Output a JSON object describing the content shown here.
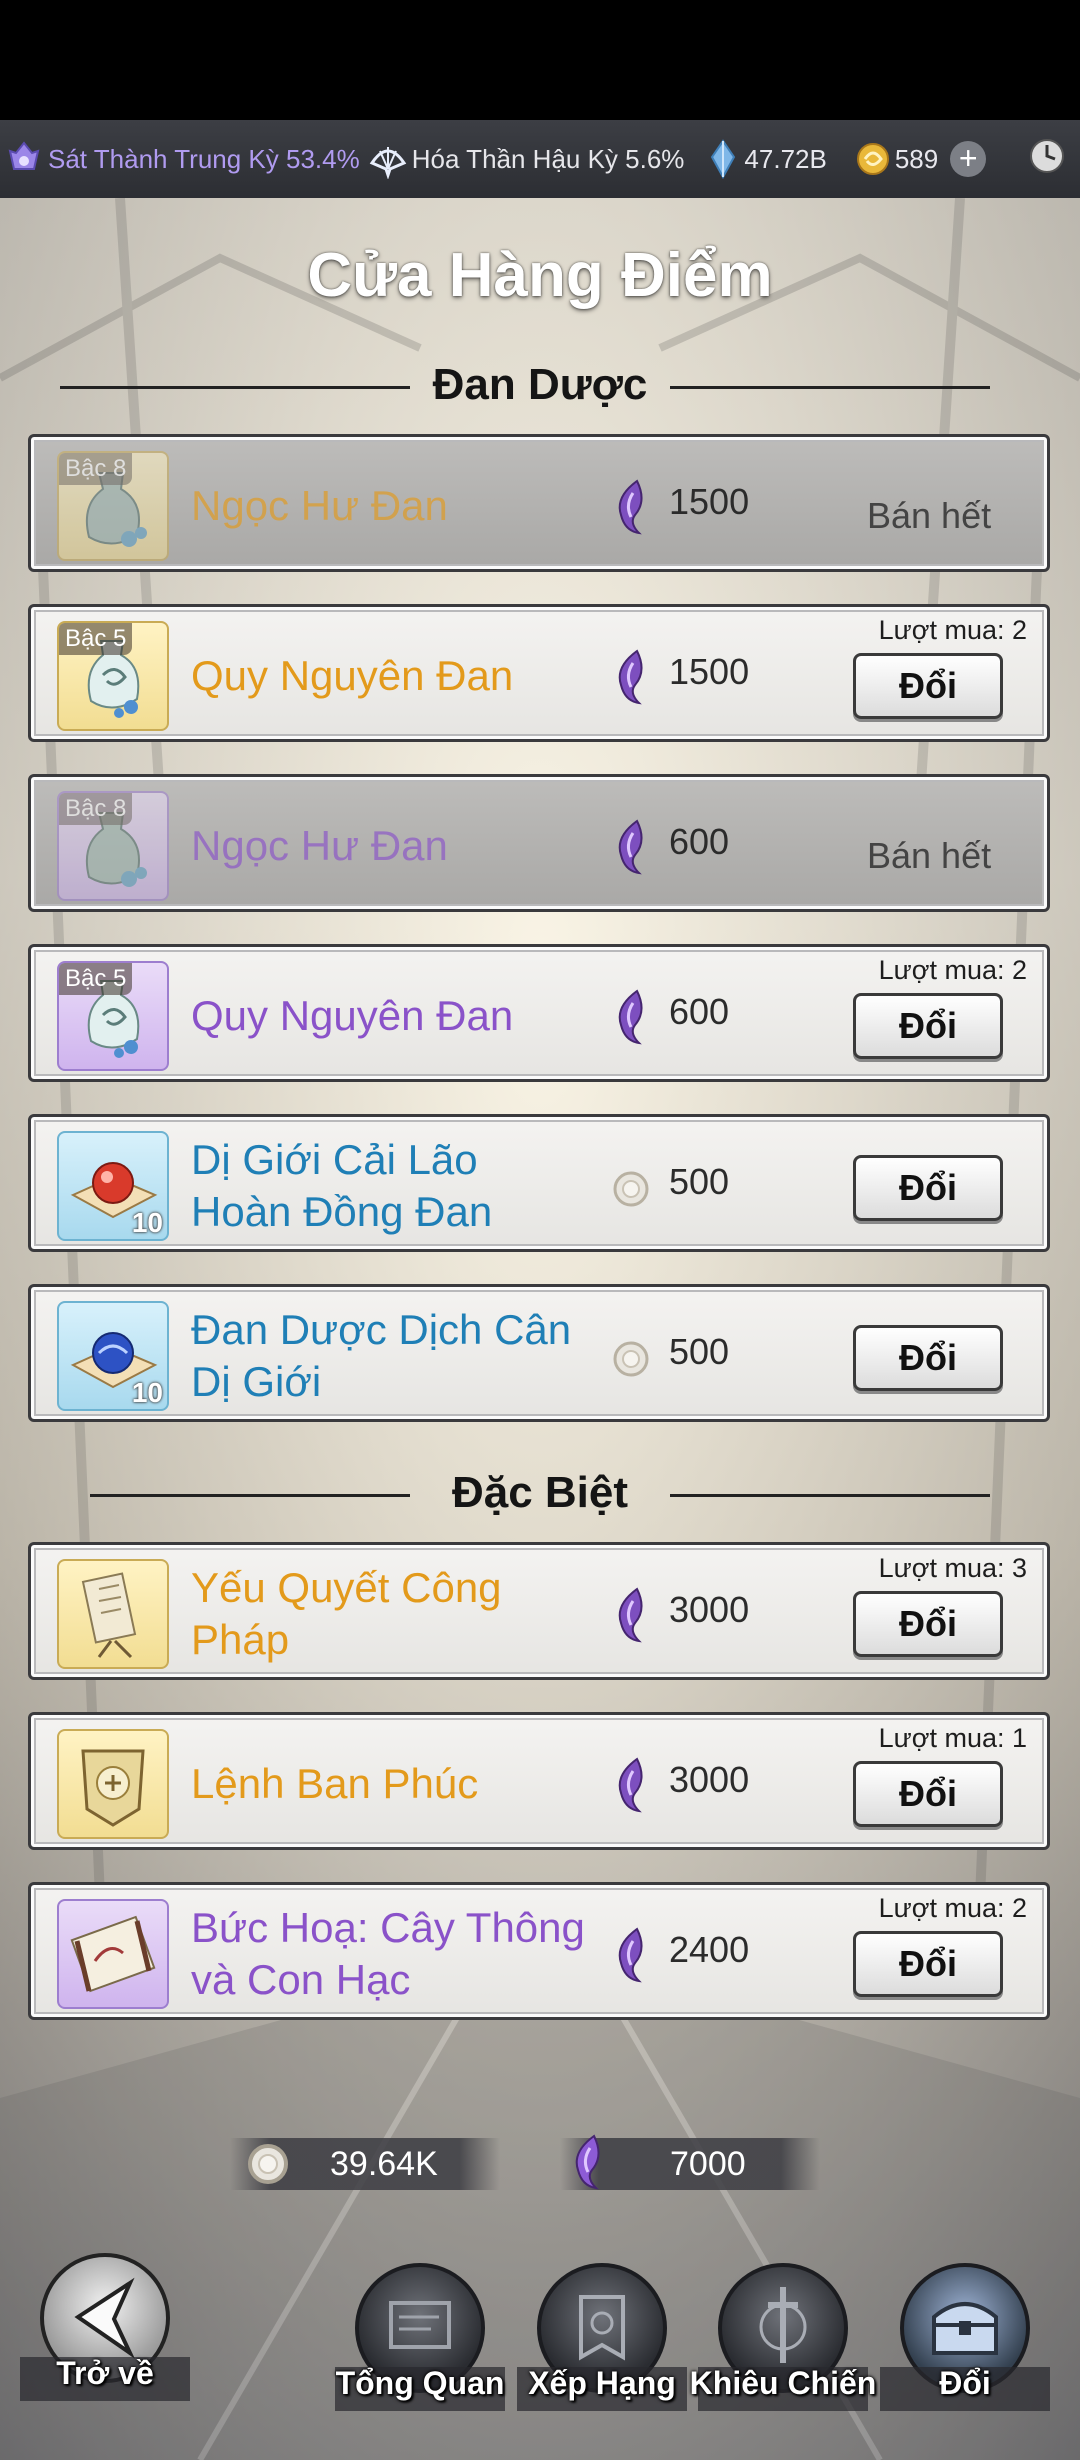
{
  "status_bar": {
    "cultivation": "Sát Thành Trung Kỳ 53.4%",
    "soul": "Hóa Thần Hậu Kỳ 5.6%",
    "gems": "47.72B",
    "coins": "589",
    "plus_icon": "plus-icon",
    "clock_icon": "clock-icon"
  },
  "title": "Cửa Hàng Điểm",
  "sections": {
    "pills": "Đan Dược",
    "special": "Đặc Biệt"
  },
  "items": [
    {
      "tier": "Bậc 8",
      "name": "Ngọc Hư Đan",
      "currency": "purple-flame",
      "price": "1500",
      "limit": "",
      "status": "Bán hết",
      "button": "",
      "color": "gold"
    },
    {
      "tier": "Bậc 5",
      "name": "Quy Nguyên Đan",
      "currency": "purple-flame",
      "price": "1500",
      "limit": "Lượt mua: 2",
      "status": "",
      "button": "Đổi",
      "color": "gold"
    },
    {
      "tier": "Bậc 8",
      "name": "Ngọc Hư Đan",
      "currency": "purple-flame",
      "price": "600",
      "limit": "",
      "status": "Bán hết",
      "button": "",
      "color": "purple"
    },
    {
      "tier": "Bậc 5",
      "name": "Quy Nguyên Đan",
      "currency": "purple-flame",
      "price": "600",
      "limit": "Lượt mua: 2",
      "status": "",
      "button": "Đổi",
      "color": "purple"
    },
    {
      "tier": "",
      "quantity": "10",
      "name_line1": "Dị Giới Cải Lão",
      "name_line2": "Hoàn Đồng Đan",
      "currency": "silver-ring",
      "price": "500",
      "limit": "",
      "status": "",
      "button": "Đổi",
      "color": "blue"
    },
    {
      "tier": "",
      "quantity": "10",
      "name_line1": "Đan Dược Dịch Cân",
      "name_line2": "Dị Giới",
      "currency": "silver-ring",
      "price": "500",
      "limit": "",
      "status": "",
      "button": "Đổi",
      "color": "blue"
    },
    {
      "name_line1": "Yếu Quyết Công",
      "name_line2": "Pháp",
      "currency": "purple-flame",
      "price": "3000",
      "limit": "Lượt mua: 3",
      "button": "Đổi",
      "color": "gold"
    },
    {
      "name": "Lệnh Ban Phúc",
      "currency": "purple-flame",
      "price": "3000",
      "limit": "Lượt mua: 1",
      "button": "Đổi",
      "color": "gold"
    },
    {
      "name_line1": "Bức Hoạ: Cây Thông",
      "name_line2": "và Con Hạc",
      "currency": "purple-flame",
      "price": "2400",
      "limit": "Lượt mua: 2",
      "button": "Đổi",
      "color": "purple"
    }
  ],
  "balances": {
    "silver_points": "39.64K",
    "flame_points": "7000"
  },
  "bottom_nav": {
    "back": "Trở về",
    "overview": "Tổng Quan",
    "ranking": "Xếp Hạng",
    "challenge": "Khiêu Chiến",
    "exchange": "Đổi"
  },
  "colors": {
    "gold_text": "#e39a1b",
    "purple_text": "#8a52c9",
    "blue_text": "#1f7fb6"
  }
}
